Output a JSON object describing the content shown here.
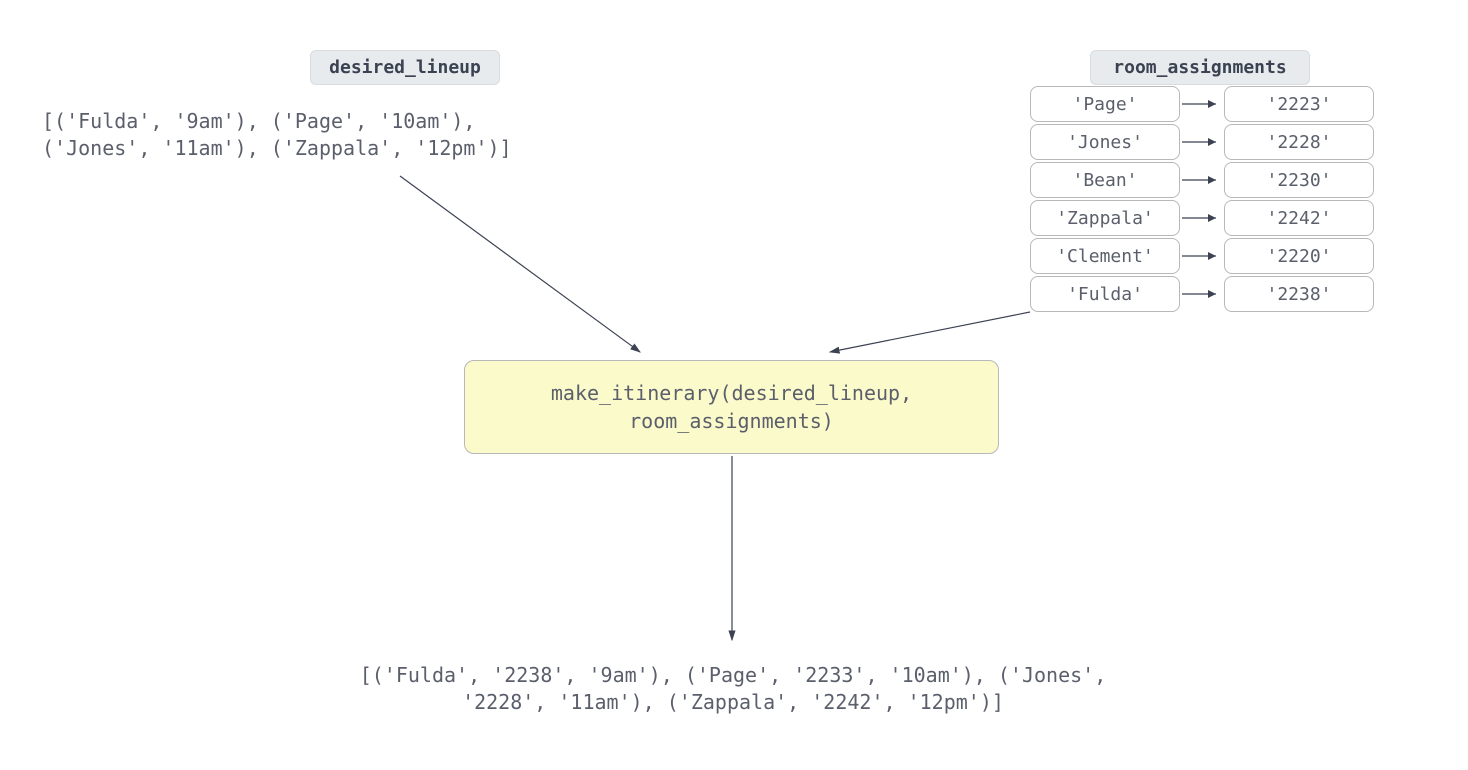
{
  "labels": {
    "desired_lineup": "desired_lineup",
    "room_assignments": "room_assignments"
  },
  "desired_lineup_text": "[('Fulda', '9am'), ('Page', '10am'),\n('Jones', '11am'), ('Zappala', '12pm')]",
  "room_assignments": [
    {
      "key": "'Page'",
      "value": "'2223'"
    },
    {
      "key": "'Jones'",
      "value": "'2228'"
    },
    {
      "key": "'Bean'",
      "value": "'2230'"
    },
    {
      "key": "'Zappala'",
      "value": "'2242'"
    },
    {
      "key": "'Clement'",
      "value": "'2220'"
    },
    {
      "key": "'Fulda'",
      "value": "'2238'"
    }
  ],
  "function_call": "make_itinerary(desired_lineup,\nroom_assignments)",
  "output_line1": "[('Fulda', '2238', '9am'), ('Page', '2233', '10am'), ('Jones',",
  "output_line2": "'2228', '11am'), ('Zappala', '2242', '12pm')]"
}
